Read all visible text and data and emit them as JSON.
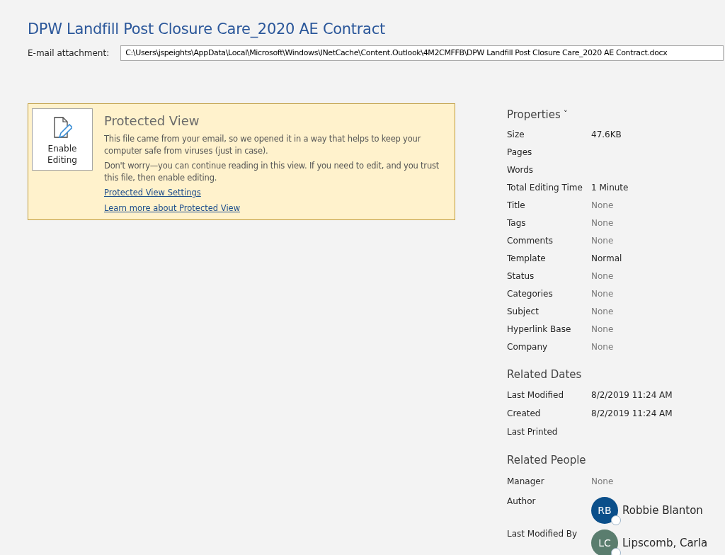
{
  "title": "DPW Landfill Post Closure Care_2020 AE Contract",
  "attachment": {
    "label": "E-mail attachment:",
    "value": "C:\\Users\\jspeights\\AppData\\Local\\Microsoft\\Windows\\INetCache\\Content.Outlook\\4M2CMFFB\\DPW Landfill Post Closure Care_2020 AE Contract.docx"
  },
  "protected_view": {
    "button": "Enable Editing",
    "heading": "Protected View",
    "paragraphs": [
      "This file came from your email, so we opened it in a way that helps to keep your computer safe from viruses (just in case).",
      "Don't worry—you can continue reading in this view. If you need to edit, and you trust this file, then enable editing."
    ],
    "links": [
      "Protected View Settings",
      "Learn more about Protected View"
    ]
  },
  "properties": {
    "heading": "Properties",
    "caret": "ˇ",
    "rows": [
      {
        "label": "Size",
        "value": "47.6KB",
        "muted": false
      },
      {
        "label": "Pages"
      },
      {
        "label": "Words"
      },
      {
        "label": "Total Editing Time",
        "value": "1 Minute",
        "muted": false
      },
      {
        "label": "Title",
        "value": "None",
        "muted": true
      },
      {
        "label": "Tags",
        "value": "None",
        "muted": true
      },
      {
        "label": "Comments",
        "value": "None",
        "muted": true
      },
      {
        "label": "Template",
        "value": "Normal",
        "muted": false
      },
      {
        "label": "Status",
        "value": "None",
        "muted": true
      },
      {
        "label": "Categories",
        "value": "None",
        "muted": true
      },
      {
        "label": "Subject",
        "value": "None",
        "muted": true
      },
      {
        "label": "Hyperlink Base",
        "value": "None",
        "muted": true
      },
      {
        "label": "Company",
        "value": "None",
        "muted": true
      }
    ]
  },
  "related_dates": {
    "heading": "Related Dates",
    "rows": [
      {
        "label": "Last Modified",
        "value": "8/2/2019 11:24 AM"
      },
      {
        "label": "Created",
        "value": "8/2/2019 11:24 AM"
      },
      {
        "label": "Last Printed"
      }
    ]
  },
  "related_people": {
    "heading": "Related People",
    "manager": {
      "label": "Manager",
      "value": "None"
    },
    "people": [
      {
        "label": "Author",
        "initials": "RB",
        "name": "Robbie Blanton",
        "color": "#0b4f8a"
      },
      {
        "label": "Last Modified By",
        "initials": "LC",
        "name": "Lipscomb, Carla",
        "color": "#5a7d6e"
      }
    ]
  }
}
